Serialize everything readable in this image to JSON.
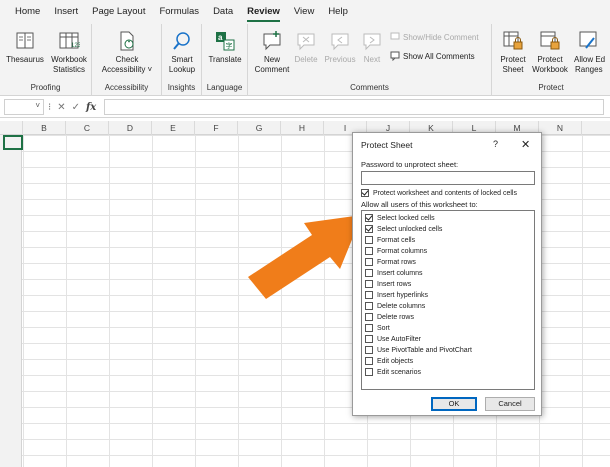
{
  "menu_tabs": [
    "Home",
    "Insert",
    "Page Layout",
    "Formulas",
    "Data",
    "Review",
    "View",
    "Help"
  ],
  "active_tab": "Review",
  "ribbon": {
    "proofing": {
      "label": "Proofing",
      "thesaurus": "Thesaurus",
      "workbook_stats_1": "Workbook",
      "workbook_stats_2": "Statistics"
    },
    "accessibility": {
      "label": "Accessibility",
      "check_1": "Check",
      "check_2": "Accessibility ˅"
    },
    "insights": {
      "label": "Insights",
      "smart_1": "Smart",
      "smart_2": "Lookup"
    },
    "language": {
      "label": "Language",
      "translate": "Translate"
    },
    "comments": {
      "label": "Comments",
      "new_1": "New",
      "new_2": "Comment",
      "delete": "Delete",
      "previous": "Previous",
      "next": "Next",
      "show_hide": "Show/Hide Comment",
      "show_all": "Show All Comments"
    },
    "protect": {
      "label": "Protect",
      "sheet_1": "Protect",
      "sheet_2": "Sheet",
      "workbook_1": "Protect",
      "workbook_2": "Workbook",
      "allow_1": "Allow Ed",
      "allow_2": "Ranges"
    }
  },
  "formula_bar": {
    "fx": "fx"
  },
  "columns": [
    "B",
    "C",
    "D",
    "E",
    "F",
    "G",
    "H",
    "I",
    "J",
    "K",
    "L",
    "M",
    "N"
  ],
  "dialog": {
    "title": "Protect Sheet",
    "help": "?",
    "close": "✕",
    "password_label": "Password to unprotect sheet:",
    "protect_checkbox": "Protect worksheet and contents of locked cells",
    "allow_label": "Allow all users of this worksheet to:",
    "options": [
      {
        "label": "Select locked cells",
        "checked": true
      },
      {
        "label": "Select unlocked cells",
        "checked": true
      },
      {
        "label": "Format cells",
        "checked": false
      },
      {
        "label": "Format columns",
        "checked": false
      },
      {
        "label": "Format rows",
        "checked": false
      },
      {
        "label": "Insert columns",
        "checked": false
      },
      {
        "label": "Insert rows",
        "checked": false
      },
      {
        "label": "Insert hyperlinks",
        "checked": false
      },
      {
        "label": "Delete columns",
        "checked": false
      },
      {
        "label": "Delete rows",
        "checked": false
      },
      {
        "label": "Sort",
        "checked": false
      },
      {
        "label": "Use AutoFilter",
        "checked": false
      },
      {
        "label": "Use PivotTable and PivotChart",
        "checked": false
      },
      {
        "label": "Edit objects",
        "checked": false
      },
      {
        "label": "Edit scenarios",
        "checked": false
      }
    ],
    "ok": "OK",
    "cancel": "Cancel"
  },
  "colors": {
    "accent": "#1e7145",
    "arrow": "#f07d1a",
    "ok_border": "#0067c0"
  }
}
